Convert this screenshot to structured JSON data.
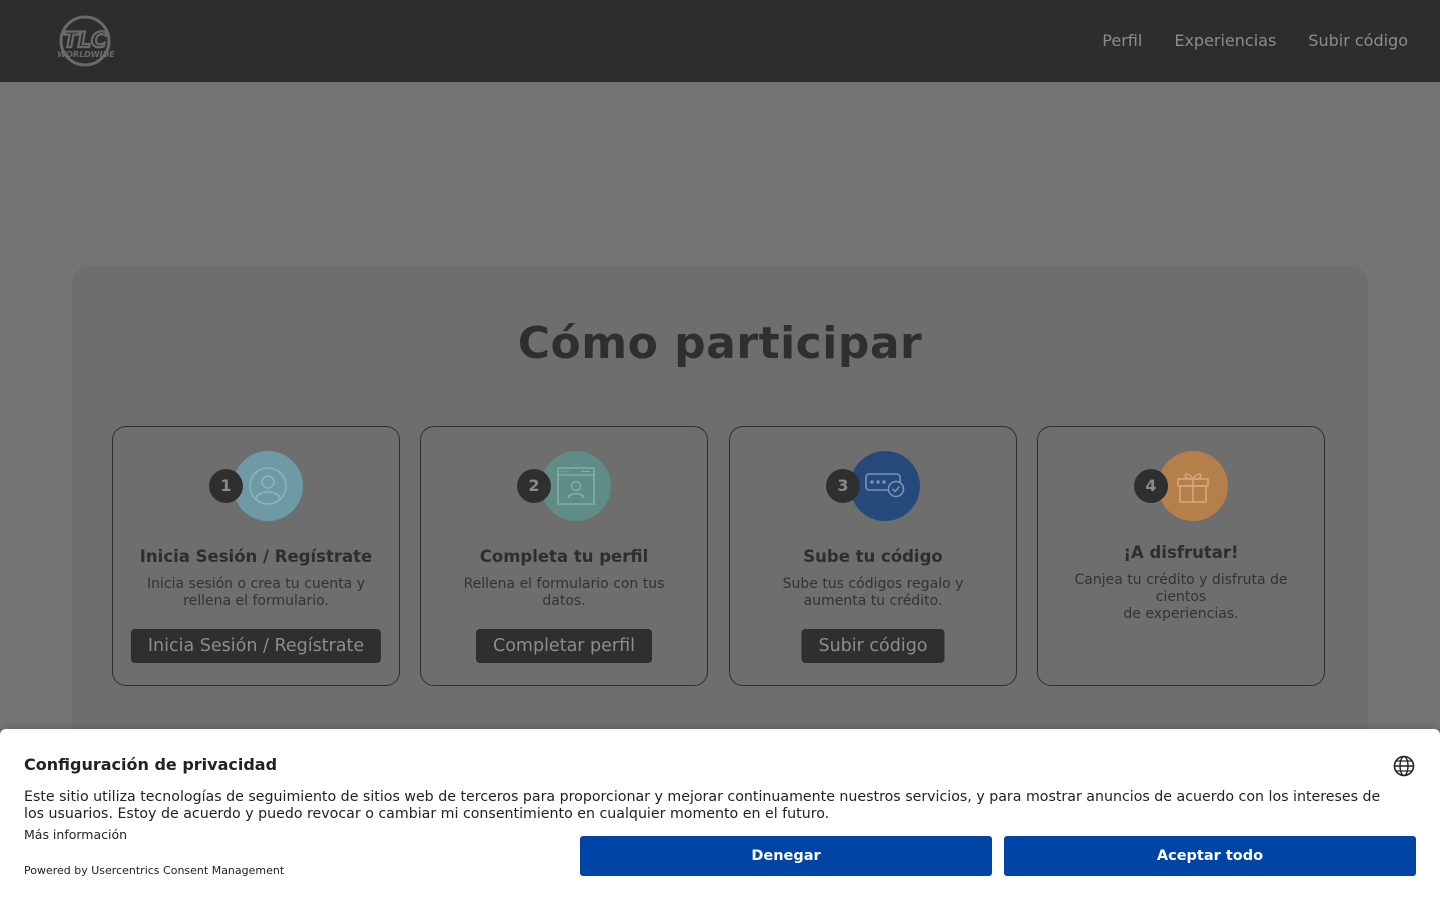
{
  "header": {
    "logo_alt": "TLC WORLDWIDE",
    "nav": [
      "Perfil",
      "Experiencias",
      "Subir código"
    ]
  },
  "main": {
    "title": "Cómo participar",
    "steps": [
      {
        "number": "1",
        "title": "Inicia Sesión / Regístrate",
        "description": "Inicia sesión o crea tu cuenta y rellena el formulario.",
        "button": "Inicia Sesión / Regístrate",
        "icon": "user-icon",
        "color": "#6e9aa6"
      },
      {
        "number": "2",
        "title": "Completa tu perfil",
        "description": "Rellena el formulario con tus datos.",
        "button": "Completar perfil",
        "icon": "profile-form-icon",
        "color": "#5f8c86"
      },
      {
        "number": "3",
        "title": "Sube tu código",
        "description": "Sube tus códigos regalo y aumenta tu crédito.",
        "button": "Subir código",
        "icon": "code-check-icon",
        "color": "#24497a"
      },
      {
        "number": "4",
        "title": "¡A disfrutar!",
        "description": "Canjea tu crédito y disfruta de cientos\nde experiencias.",
        "button": "",
        "icon": "gift-icon",
        "color": "#b57f4a"
      }
    ]
  },
  "consent": {
    "title": "Configuración de privacidad",
    "description": "Este sitio utiliza tecnologías de seguimiento de sitios web de terceros para proporcionar y mejorar continuamente nuestros servicios, y para mostrar anuncios de acuerdo con los intereses de los usuarios. Estoy de acuerdo y puedo revocar o cambiar mi consentimiento en cualquier momento en el futuro.",
    "more_info": "Más información",
    "powered_by": "Powered by Usercentrics Consent Management",
    "deny_button": "Denegar",
    "accept_button": "Aceptar todo",
    "accent_color": "#0045a5"
  }
}
